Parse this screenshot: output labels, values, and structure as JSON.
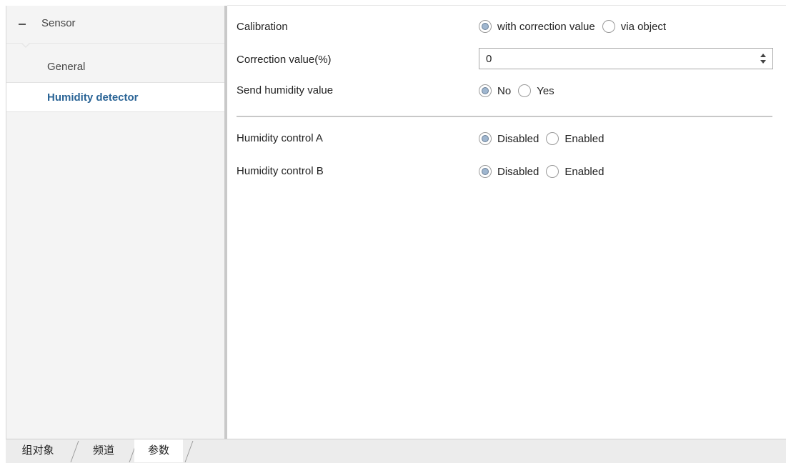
{
  "tree": {
    "header": "Sensor",
    "items": [
      {
        "label": "General"
      },
      {
        "label": "Humidity detector"
      }
    ]
  },
  "params": {
    "calibration": {
      "label": "Calibration",
      "options": [
        "with correction value",
        "via object"
      ],
      "selected": "with correction value"
    },
    "correction": {
      "label": "Correction value(%)",
      "value": "0"
    },
    "send_humidity": {
      "label": "Send humidity value",
      "options": [
        "No",
        "Yes"
      ],
      "selected": "No"
    },
    "control_a": {
      "label": "Humidity control A",
      "options": [
        "Disabled",
        "Enabled"
      ],
      "selected": "Disabled"
    },
    "control_b": {
      "label": "Humidity control B",
      "options": [
        "Disabled",
        "Enabled"
      ],
      "selected": "Disabled"
    }
  },
  "bottom_tabs": [
    "组对象",
    "频道",
    "参数"
  ],
  "colors": {
    "active_text": "#2a6496",
    "radio_fill": "#9fb6cf"
  }
}
